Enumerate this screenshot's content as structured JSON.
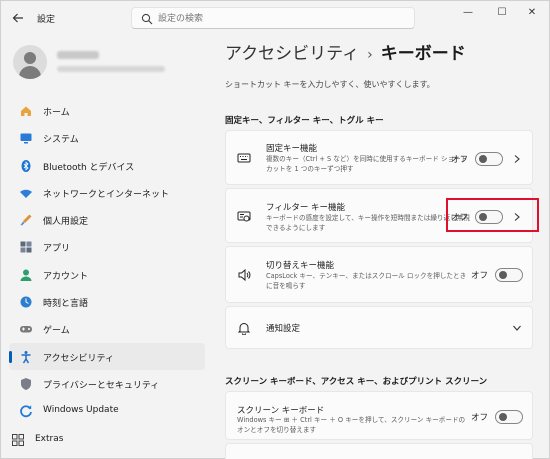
{
  "window": {
    "app_title": "設定",
    "controls": [
      "—",
      "☐",
      "✕"
    ]
  },
  "search": {
    "placeholder": "設定の検索",
    "value": ""
  },
  "sidebar": {
    "items": [
      {
        "label": "ホーム",
        "icon": "home-icon",
        "color": "#e8a33d"
      },
      {
        "label": "システム",
        "icon": "system-icon",
        "color": "#2b79d6"
      },
      {
        "label": "Bluetooth とデバイス",
        "icon": "bluetooth-icon",
        "color": "#1a73d4"
      },
      {
        "label": "ネットワークとインターネット",
        "icon": "network-icon",
        "color": "#2c7ed8"
      },
      {
        "label": "個人用設定",
        "icon": "personalization-icon",
        "color": "#d8933b"
      },
      {
        "label": "アプリ",
        "icon": "apps-icon",
        "color": "#5d6a7c"
      },
      {
        "label": "アカウント",
        "icon": "account-icon",
        "color": "#2e9e6c"
      },
      {
        "label": "時刻と言語",
        "icon": "time-language-icon",
        "color": "#2a7fcf"
      },
      {
        "label": "ゲーム",
        "icon": "gaming-icon",
        "color": "#7b7b7b"
      },
      {
        "label": "アクセシビリティ",
        "icon": "accessibility-icon",
        "color": "#1a6fc9",
        "active": true
      },
      {
        "label": "プライバシーとセキュリティ",
        "icon": "privacy-shield-icon",
        "color": "#7a7f87"
      },
      {
        "label": "Windows Update",
        "icon": "windows-update-icon",
        "color": "#1f7ad8"
      }
    ],
    "extras_label": "Extras"
  },
  "page": {
    "parent": "アクセシビリティ",
    "separator": "›",
    "current": "キーボード",
    "subtitle": "ショートカット キーを入力しやすく、使いやすくします。"
  },
  "sections": {
    "keys_heading": "固定キー、フィルター キー、トグル キー",
    "screen_kb_heading": "スクリーン キーボード、アクセス キー、およびプリント スクリーン"
  },
  "cards": {
    "sticky": {
      "title": "固定キー機能",
      "desc": "複数のキー（Ctrl + S など）を同時に使用するキーボード ショートカットを 1 つのキーずつ押す",
      "state": "オフ"
    },
    "filter": {
      "title": "フィルター キー機能",
      "desc": "キーボードの感度を設定して、キー操作を短時間または繰り返し無視できるようにします",
      "state": "オフ"
    },
    "toggle": {
      "title": "切り替えキー機能",
      "desc": "CapsLock キー、テンキー、またはスクロール ロックを押したときに音を鳴らす",
      "state": "オフ"
    },
    "notify": {
      "title": "通知設定"
    },
    "screen_kb": {
      "title": "スクリーン キーボード",
      "desc": "Windows キー ⊞ ＋ Ctrl キー ＋ O キーを押して、スクリーン キーボードのオンとオフを切り替えます",
      "state": "オフ"
    }
  },
  "colors": {
    "accent": "#005fb8",
    "highlight": "#e0102c"
  }
}
